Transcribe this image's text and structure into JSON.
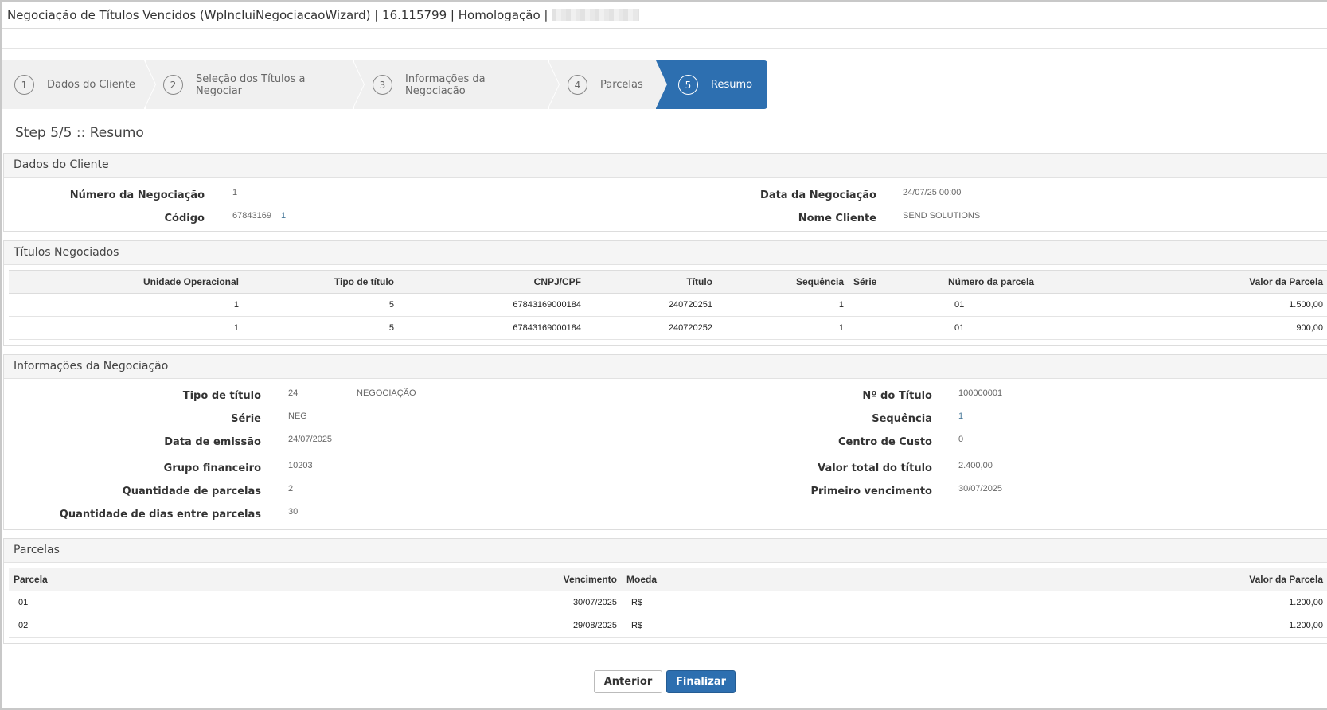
{
  "window": {
    "title": "Negociação de Títulos Vencidos (WpIncluiNegociacaoWizard) | 16.115799 | Homologação |"
  },
  "wizard": {
    "steps": [
      {
        "num": "1",
        "label": "Dados do Cliente"
      },
      {
        "num": "2",
        "label": "Seleção dos Títulos a Negociar"
      },
      {
        "num": "3",
        "label": "Informações da Negociação"
      },
      {
        "num": "4",
        "label": "Parcelas"
      },
      {
        "num": "5",
        "label": "Resumo"
      }
    ],
    "active_step": 5,
    "active_color": "#2d6fb0"
  },
  "step_heading": "Step 5/5 :: Resumo",
  "cliente": {
    "title": "Dados do Cliente",
    "numero_label": "Número da Negociação",
    "numero_value": "1",
    "codigo_label": "Código",
    "codigo_value": "67843169",
    "codigo_value2": "1",
    "data_label": "Data da Negociação",
    "data_value": "24/07/25 00:00",
    "nome_label": "Nome Cliente",
    "nome_value": "SEND SOLUTIONS"
  },
  "titulos": {
    "title": "Títulos Negociados",
    "columns": [
      "Unidade Operacional",
      "Tipo de título",
      "CNPJ/CPF",
      "Título",
      "Sequência",
      "Série",
      "Número da parcela",
      "Valor da Parcela"
    ],
    "rows": [
      [
        "1",
        "5",
        "67843169000184",
        "240720251",
        "1",
        "",
        "01",
        "1.500,00"
      ],
      [
        "1",
        "5",
        "67843169000184",
        "240720252",
        "1",
        "",
        "01",
        "900,00"
      ]
    ]
  },
  "info": {
    "title": "Informações da Negociação",
    "tipo_label": "Tipo de título",
    "tipo_value": "24",
    "tipo_desc": "NEGOCIAÇÃO",
    "serie_label": "Série",
    "serie_value": "NEG",
    "emissao_label": "Data de emissão",
    "emissao_value": "24/07/2025",
    "grupo_label": "Grupo financeiro",
    "grupo_value": "10203",
    "qtd_label": "Quantidade de parcelas",
    "qtd_value": "2",
    "dias_label": "Quantidade de dias entre parcelas",
    "dias_value": "30",
    "ntitulo_label": "Nº do Título",
    "ntitulo_value": "100000001",
    "seq_label": "Sequência",
    "seq_value": "1",
    "centro_label": "Centro de Custo",
    "centro_value": "0",
    "valor_label": "Valor total do título",
    "valor_value": "2.400,00",
    "venc_label": "Primeiro vencimento",
    "venc_value": "30/07/2025"
  },
  "parcelas": {
    "title": "Parcelas",
    "columns": [
      "Parcela",
      "Vencimento",
      "Moeda",
      "Valor da Parcela"
    ],
    "rows": [
      [
        "01",
        "30/07/2025",
        "R$",
        "1.200,00"
      ],
      [
        "02",
        "29/08/2025",
        "R$",
        "1.200,00"
      ]
    ]
  },
  "buttons": {
    "prev": "Anterior",
    "finish": "Finalizar"
  }
}
